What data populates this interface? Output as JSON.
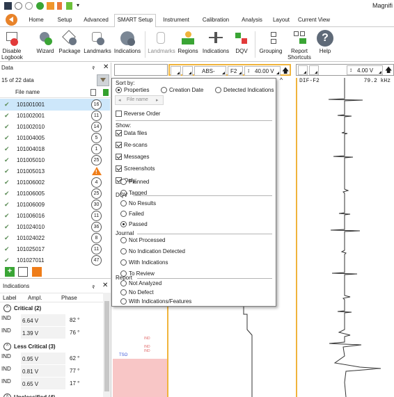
{
  "app_title": "Magnifi",
  "tabs": [
    {
      "label": "Home",
      "active": false
    },
    {
      "label": "Setup",
      "active": false
    },
    {
      "label": "Advanced",
      "active": false
    },
    {
      "label": "SMART Setup",
      "active": true
    },
    {
      "label": "Instrument",
      "active": false
    },
    {
      "label": "Calibration",
      "active": false
    },
    {
      "label": "Analysis",
      "active": false
    },
    {
      "label": "Layout",
      "active": false
    },
    {
      "label": "Current View",
      "active": false
    }
  ],
  "ribbon": {
    "buttons": [
      {
        "label": "Disable",
        "label2": "Logbook",
        "icon": "logbook-disable-icon",
        "enabled": true
      },
      {
        "label": "Wizard",
        "label2": "",
        "icon": "wizard-ai-icon",
        "enabled": true
      },
      {
        "label": "Package",
        "label2": "",
        "icon": "package-ai-icon",
        "enabled": true
      },
      {
        "label": "Landmarks",
        "label2": "",
        "icon": "landmarks-ai-icon",
        "enabled": true
      },
      {
        "label": "Indications",
        "label2": "",
        "icon": "indications-ai-icon",
        "enabled": true
      },
      {
        "label": "Landmarks",
        "label2": "",
        "icon": "landmarks-icon",
        "enabled": false
      },
      {
        "label": "Regions",
        "label2": "",
        "icon": "regions-icon",
        "enabled": true
      },
      {
        "label": "Indications",
        "label2": "",
        "icon": "indications-icon",
        "enabled": true
      },
      {
        "label": "DQV",
        "label2": "",
        "icon": "dqv-icon",
        "enabled": true
      },
      {
        "label": "Grouping",
        "label2": "",
        "icon": "grouping-icon",
        "enabled": true
      },
      {
        "label": "Report",
        "label2": "Shortcuts",
        "icon": "report-shortcuts-icon",
        "enabled": true
      },
      {
        "label": "Help",
        "label2": "",
        "icon": "help-icon",
        "enabled": true
      }
    ]
  },
  "data_panel": {
    "title": "Data",
    "pin": "२",
    "close": "✕",
    "count_text": "15 of 22 data",
    "column_header": "File name",
    "files": [
      {
        "name": "101001001",
        "count": "16",
        "warning": false,
        "selected": true
      },
      {
        "name": "101002001",
        "count": "11",
        "warning": false,
        "selected": false
      },
      {
        "name": "101002010",
        "count": "14",
        "warning": false,
        "selected": false
      },
      {
        "name": "101004005",
        "count": "5",
        "warning": false,
        "selected": false
      },
      {
        "name": "101004018",
        "count": "1",
        "warning": false,
        "selected": false
      },
      {
        "name": "101005010",
        "count": "25",
        "warning": false,
        "selected": false
      },
      {
        "name": "101005013",
        "count": "!",
        "warning": true,
        "selected": false
      },
      {
        "name": "101006002",
        "count": "4",
        "warning": false,
        "selected": false
      },
      {
        "name": "101006005",
        "count": "25",
        "warning": false,
        "selected": false
      },
      {
        "name": "101006009",
        "count": "30",
        "warning": false,
        "selected": false
      },
      {
        "name": "101006016",
        "count": "11",
        "warning": false,
        "selected": false
      },
      {
        "name": "101024010",
        "count": "36",
        "warning": false,
        "selected": false
      },
      {
        "name": "101024022",
        "count": "8",
        "warning": false,
        "selected": false
      },
      {
        "name": "101025017",
        "count": "11",
        "warning": false,
        "selected": false
      },
      {
        "name": "101027011",
        "count": "47",
        "warning": false,
        "selected": false
      }
    ]
  },
  "indications_panel": {
    "title": "Indications",
    "pin": "२",
    "close": "✕",
    "columns": [
      "Label",
      "Ampl.",
      "Phase"
    ],
    "groups": [
      {
        "label": "Critical (2)",
        "rows": [
          {
            "label": "IND",
            "ampl": "6.64 V",
            "phase": "82 °"
          },
          {
            "label": "IND",
            "ampl": "1.39 V",
            "phase": "76 °"
          }
        ]
      },
      {
        "label": "Less Critical (3)",
        "rows": [
          {
            "label": "IND",
            "ampl": "0.95 V",
            "phase": "62 °"
          },
          {
            "label": "IND",
            "ampl": "0.81 V",
            "phase": "77 °"
          },
          {
            "label": "IND",
            "ampl": "0.65 V",
            "phase": "17 °"
          }
        ]
      },
      {
        "label": "Unclassified (4)",
        "rows": []
      }
    ]
  },
  "channel_mid": {
    "mode": "ABS-",
    "freq": "F2",
    "volts": "40.00 V"
  },
  "channel_right": {
    "volts": "4.00 V",
    "name": "DIF-F2",
    "hz": "79.2 kHz"
  },
  "plot_labels": {
    "ind1": "IND",
    "ind2": "IND",
    "ind3": "IND",
    "tso": "TSO"
  },
  "sort_popup": {
    "sort_by_label": "Sort by:",
    "sort_options": [
      {
        "label": "Properties",
        "selected": true
      },
      {
        "label": "Creation Date",
        "selected": false
      },
      {
        "label": "Detected Indications",
        "selected": false
      }
    ],
    "file_name_chip": "File name",
    "reverse_order": {
      "label": "Reverse Order",
      "checked": false
    },
    "show_label": "Show:",
    "show_options": [
      {
        "label": "Data files",
        "checked": true
      },
      {
        "label": "Re-scans",
        "checked": true
      },
      {
        "label": "Messages",
        "checked": true
      },
      {
        "label": "Screenshots",
        "checked": true
      },
      {
        "label": "Only:",
        "checked": true
      }
    ],
    "only_options": [
      {
        "label": "Planned",
        "selected": false
      },
      {
        "label": "Tagged",
        "selected": false
      }
    ],
    "dqv_label": "DQV",
    "dqv_options": [
      {
        "label": "No Results",
        "selected": false
      },
      {
        "label": "Failed",
        "selected": false
      },
      {
        "label": "Passed",
        "selected": true
      }
    ],
    "journal_label": "Journal",
    "journal_options": [
      {
        "label": "Not Processed",
        "selected": false
      },
      {
        "label": "No Indication Detected",
        "selected": false
      },
      {
        "label": "With Indications",
        "selected": false
      },
      {
        "label": "To Review",
        "selected": false
      }
    ],
    "report_label": "Report",
    "report_options": [
      {
        "label": "Not Analyzed",
        "selected": false
      },
      {
        "label": "No Defect",
        "selected": false
      },
      {
        "label": "With Indications/Features",
        "selected": false
      }
    ]
  },
  "colors": {
    "accent_orange": "#f0b43c",
    "selected_row": "#cde7fa",
    "alarm_pink": "#f8c6c6",
    "tso_blue": "#3a55d8",
    "ind_red": "#e06b6b",
    "ok_green": "#34a12e"
  }
}
